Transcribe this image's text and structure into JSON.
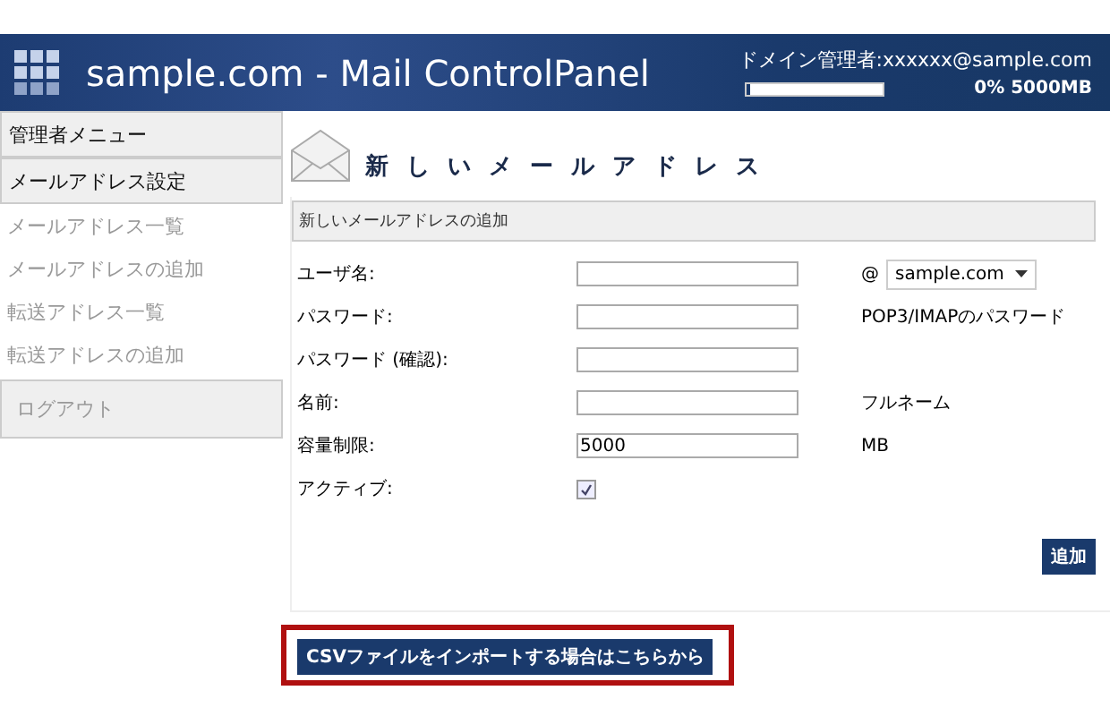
{
  "header": {
    "title": "sample.com - Mail ControlPanel",
    "admin": "ドメイン管理者:xxxxxx@sample.com",
    "quota": {
      "level": 0.02,
      "reading": "0% 5000MB"
    }
  },
  "sidebar": {
    "heading": "管理者メニュー",
    "section": "メールアドレス設定",
    "items": [
      {
        "label": "メールアドレス一覧",
        "selected": false
      },
      {
        "label": "メールアドレスの追加",
        "selected": false
      },
      {
        "label": "転送アドレス一覧",
        "selected": false
      },
      {
        "label": "転送アドレスの追加",
        "selected": false
      }
    ],
    "logout": "ログアウト"
  },
  "page_title": "新しいメールアドレス",
  "form": {
    "section": "新しいメールアドレスの追加",
    "rows": [
      {
        "kind": "text",
        "label": "ユーザ名:",
        "value": "",
        "at": "@",
        "domain": "sample.com"
      },
      {
        "kind": "password",
        "label": "パスワード:",
        "value": "",
        "hint": "POP3/IMAPのパスワード"
      },
      {
        "kind": "password",
        "label": "パスワード (確認):",
        "value": ""
      },
      {
        "kind": "text",
        "label": "名前:",
        "value": "",
        "hint": "フルネーム"
      },
      {
        "kind": "text",
        "label": "容量制限:",
        "value": "5000",
        "hint": "MB"
      },
      {
        "kind": "checkbox",
        "label": "アクティブ:",
        "checked": true
      }
    ],
    "submit": "追加"
  },
  "csv_button": {
    "label": "CSVファイルをインポートする場合はこちらから",
    "highlighted": true
  }
}
